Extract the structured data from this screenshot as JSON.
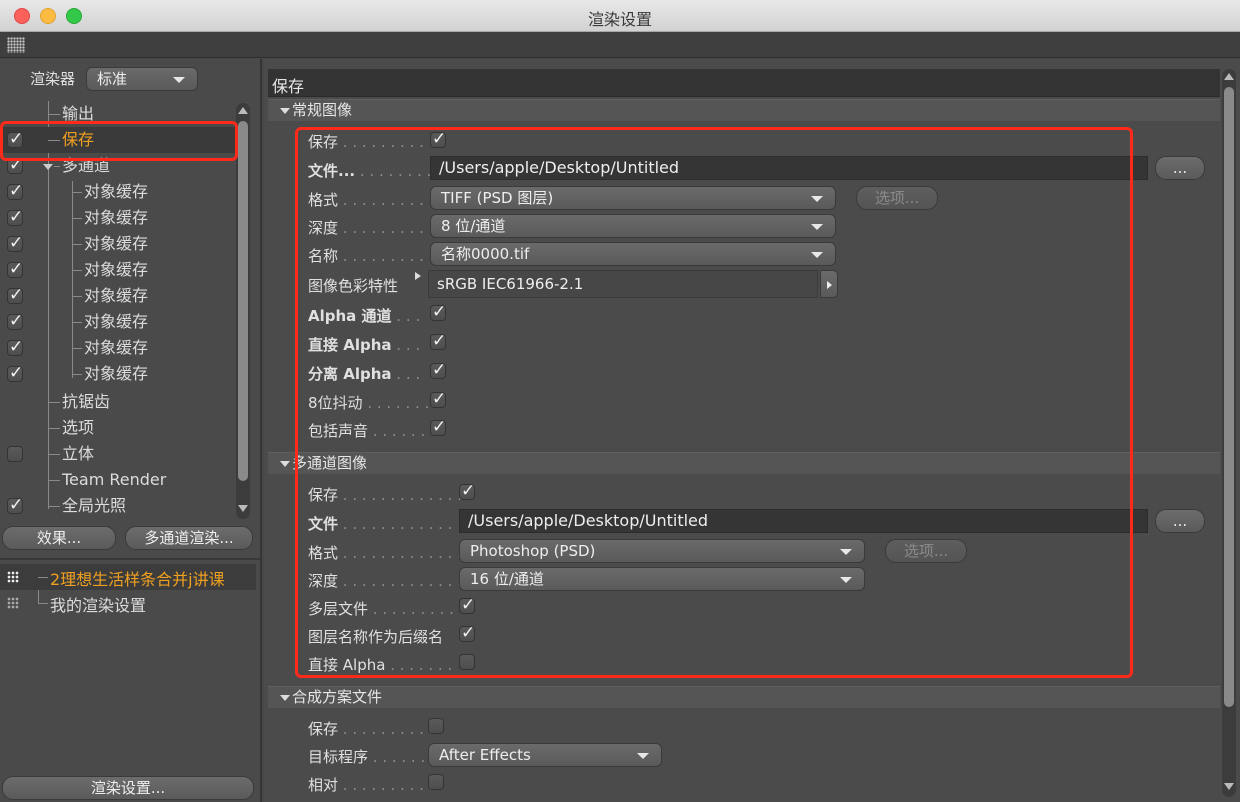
{
  "window": {
    "title": "渲染设置"
  },
  "renderer": {
    "label": "渲染器",
    "value": "标准"
  },
  "tree": {
    "items": [
      {
        "label": "输出",
        "checked": null
      },
      {
        "label": "保存",
        "checked": true,
        "selected": true
      },
      {
        "label": "多通道",
        "checked": true
      },
      {
        "label": "对象缓存",
        "checked": true
      },
      {
        "label": "对象缓存",
        "checked": true
      },
      {
        "label": "对象缓存",
        "checked": true
      },
      {
        "label": "对象缓存",
        "checked": true
      },
      {
        "label": "对象缓存",
        "checked": true
      },
      {
        "label": "对象缓存",
        "checked": true
      },
      {
        "label": "对象缓存",
        "checked": true
      },
      {
        "label": "对象缓存",
        "checked": true
      },
      {
        "label": "抗锯齿",
        "checked": null
      },
      {
        "label": "选项",
        "checked": null
      },
      {
        "label": "立体",
        "checked": false
      },
      {
        "label": "Team Render",
        "checked": null
      },
      {
        "label": "全局光照",
        "checked": true
      }
    ]
  },
  "left_buttons": {
    "effects": "效果...",
    "multipass": "多通道渲染..."
  },
  "settings_list": {
    "items": [
      {
        "label": "2理想生活样条合并j讲课",
        "active": true
      },
      {
        "label": "我的渲染设置",
        "active": false
      }
    ],
    "render_settings_button": "渲染设置..."
  },
  "panel": {
    "title": "保存",
    "regular": {
      "header": "常规图像",
      "save_label": "保存",
      "save_checked": true,
      "file_label": "文件...",
      "file_path": "/Users/apple/Desktop/Untitled",
      "browse": "...",
      "format_label": "格式",
      "format_value": "TIFF (PSD 图层)",
      "options": "选项...",
      "depth_label": "深度",
      "depth_value": "8 位/通道",
      "name_label": "名称",
      "name_value": "名称0000.tif",
      "profile_label": "图像色彩特性",
      "profile_value": "sRGB IEC61966-2.1",
      "alpha_label": "Alpha 通道",
      "alpha_checked": true,
      "straight_label": "直接 Alpha",
      "straight_checked": true,
      "separate_label": "分离 Alpha",
      "separate_checked": true,
      "dither_label": "8位抖动",
      "dither_checked": true,
      "sound_label": "包括声音",
      "sound_checked": true
    },
    "multipass": {
      "header": "多通道图像",
      "save_label": "保存",
      "save_checked": true,
      "file_label": "文件",
      "file_path": "/Users/apple/Desktop/Untitled",
      "browse": "...",
      "format_label": "格式",
      "format_value": "Photoshop (PSD)",
      "options": "选项...",
      "depth_label": "深度",
      "depth_value": "16 位/通道",
      "layered_label": "多层文件",
      "layered_checked": true,
      "suffix_label": "图层名称作为后缀名",
      "suffix_checked": true,
      "straight_label": "直接 Alpha",
      "straight_checked": false
    },
    "compositing": {
      "header": "合成方案文件",
      "save_label": "保存",
      "save_checked": false,
      "target_label": "目标程序",
      "target_value": "After Effects",
      "relative_label": "相对",
      "relative_checked": false
    }
  },
  "colors": {
    "accent": "#f0a020",
    "annotation": "#ff2a1a"
  }
}
